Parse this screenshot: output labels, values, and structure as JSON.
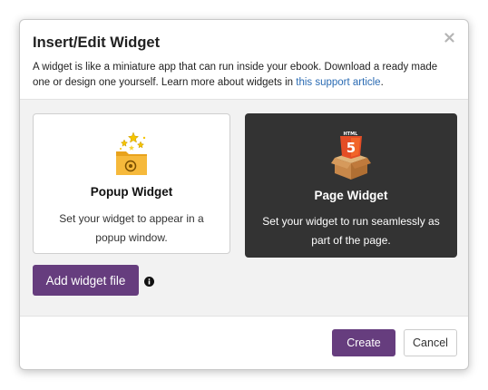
{
  "dialog": {
    "title": "Insert/Edit Widget",
    "close_icon": "close-icon",
    "description_text": "A widget is like a miniature app that can run inside your ebook. Download a ready made one or design one yourself. Learn more about widgets in ",
    "description_link": "this support article",
    "description_end": "."
  },
  "cards": {
    "popup": {
      "icon": "folder-sparkle-icon",
      "title": "Popup Widget",
      "description": "Set your widget to appear in a popup window."
    },
    "page": {
      "icon": "html5-box-icon",
      "icon_text": "5",
      "title": "Page Widget",
      "description": "Set your widget to run seamlessly as part of the page.",
      "selected": true
    }
  },
  "actions": {
    "add_widget_file": "Add widget file",
    "info_icon": "info-icon",
    "create": "Create",
    "cancel": "Cancel"
  },
  "colors": {
    "primary": "#663d7e",
    "selected_card": "#333333",
    "link": "#2a6bb3"
  }
}
